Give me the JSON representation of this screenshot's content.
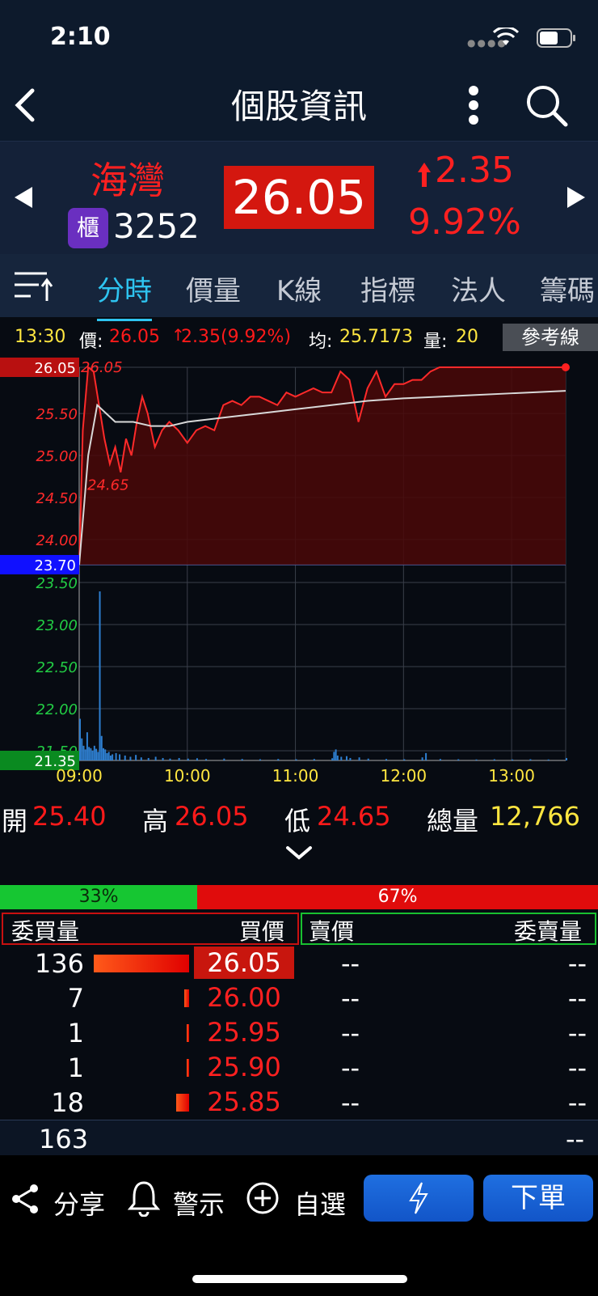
{
  "status_bar": {
    "time": "2:10"
  },
  "header": {
    "title": "個股資訊"
  },
  "stock": {
    "name": "海灣",
    "market_badge": "櫃",
    "code": "3252",
    "price": "26.05",
    "change": "2.35",
    "change_pct": "9.92%"
  },
  "tabs": [
    {
      "label": "分時",
      "active": true
    },
    {
      "label": "價量"
    },
    {
      "label": "K線"
    },
    {
      "label": "指標"
    },
    {
      "label": "法人"
    },
    {
      "label": "籌碼"
    }
  ],
  "info_line": {
    "time": "13:30",
    "price_label": "價:",
    "price": "26.05",
    "change": "2.35(9.92%)",
    "avg_label": "均:",
    "avg": "25.7173",
    "vol_label": "量:",
    "vol": "20",
    "ref_button": "參考線"
  },
  "chart_data": {
    "type": "line",
    "x_ticks": [
      "09:00",
      "10:00",
      "11:00",
      "12:00",
      "13:00"
    ],
    "price_axis": {
      "labels": [
        "26.05",
        "25.50",
        "25.00",
        "24.50",
        "24.00",
        "23.70"
      ],
      "reference": "23.70",
      "high": "26.05",
      "low": "24.65",
      "ylim": [
        23.7,
        26.05
      ]
    },
    "volume_axis": {
      "labels": [
        "23.50",
        "23.00",
        "22.50",
        "22.00",
        "21.50",
        "21.35"
      ],
      "ylim": [
        21.35,
        23.7
      ]
    },
    "price_series": {
      "x": [
        0,
        2,
        5,
        8,
        11,
        14,
        17,
        20,
        23,
        26,
        29,
        32,
        35,
        38,
        42,
        46,
        50,
        55,
        60,
        65,
        70,
        75,
        80,
        85,
        90,
        95,
        100,
        105,
        110,
        115,
        120,
        125,
        130,
        135,
        140,
        145,
        150,
        155,
        160,
        165,
        170,
        175,
        180,
        185,
        190,
        195,
        200,
        205,
        210,
        215,
        220,
        225,
        230,
        235,
        240,
        245,
        250,
        255,
        260,
        265,
        270
      ],
      "y": [
        23.7,
        25.3,
        26.05,
        26.0,
        25.6,
        25.2,
        24.9,
        25.1,
        24.8,
        25.2,
        25.0,
        25.4,
        25.7,
        25.5,
        25.1,
        25.3,
        25.4,
        25.3,
        25.15,
        25.3,
        25.35,
        25.3,
        25.6,
        25.65,
        25.6,
        25.7,
        25.7,
        25.65,
        25.6,
        25.75,
        25.7,
        25.75,
        25.8,
        25.75,
        25.75,
        26.0,
        25.9,
        25.4,
        25.8,
        26.0,
        25.7,
        25.85,
        25.85,
        25.9,
        25.9,
        26.0,
        26.05,
        26.05,
        26.05,
        26.05,
        26.05,
        26.05,
        26.05,
        26.05,
        26.05,
        26.05,
        26.05,
        26.05,
        26.05,
        26.05,
        26.05
      ]
    },
    "avg_series": {
      "x": [
        0,
        5,
        10,
        15,
        20,
        30,
        40,
        50,
        60,
        80,
        100,
        120,
        140,
        160,
        180,
        200,
        220,
        240,
        270
      ],
      "y": [
        23.7,
        25.0,
        25.6,
        25.5,
        25.4,
        25.4,
        25.35,
        25.35,
        25.4,
        25.45,
        25.5,
        25.55,
        25.6,
        25.65,
        25.68,
        25.7,
        25.72,
        25.74,
        25.77
      ]
    },
    "volume_series": {
      "x": [
        0,
        1,
        2,
        3,
        4,
        5,
        6,
        7,
        8,
        9,
        10,
        11,
        12,
        13,
        14,
        15,
        16,
        17,
        18,
        20,
        22,
        25,
        28,
        31,
        34,
        38,
        42,
        46,
        50,
        55,
        60,
        65,
        70,
        80,
        90,
        100,
        110,
        120,
        130,
        140,
        141,
        142,
        143,
        145,
        148,
        150,
        155,
        160,
        170,
        180,
        190,
        192,
        200,
        210,
        220,
        230,
        240,
        250,
        260,
        270
      ],
      "y": [
        340,
        180,
        120,
        90,
        230,
        110,
        100,
        80,
        120,
        95,
        70,
        1380,
        200,
        100,
        90,
        60,
        70,
        40,
        50,
        60,
        50,
        40,
        30,
        45,
        25,
        20,
        30,
        20,
        15,
        20,
        15,
        18,
        12,
        15,
        12,
        10,
        12,
        10,
        12,
        18,
        70,
        90,
        40,
        30,
        35,
        20,
        25,
        15,
        12,
        10,
        25,
        60,
        12,
        10,
        8,
        10,
        8,
        10,
        8,
        20
      ]
    }
  },
  "stats": {
    "open_label": "開",
    "open": "25.40",
    "high_label": "高",
    "high": "26.05",
    "low_label": "低",
    "low": "24.65",
    "total_label": "總量",
    "total": "12,766"
  },
  "ratio": {
    "buy": "33%",
    "sell": "67%",
    "buy_fraction": 0.33
  },
  "orderbook": {
    "headers": {
      "bid_qty": "委買量",
      "bid_price": "買價",
      "ask_price": "賣價",
      "ask_qty": "委賣量"
    },
    "rows": [
      {
        "qty": "136",
        "qty_num": 136,
        "bid": "26.05",
        "ask": "--",
        "ask_qty": "--"
      },
      {
        "qty": "7",
        "qty_num": 7,
        "bid": "26.00",
        "ask": "--",
        "ask_qty": "--"
      },
      {
        "qty": "1",
        "qty_num": 1,
        "bid": "25.95",
        "ask": "--",
        "ask_qty": "--"
      },
      {
        "qty": "1",
        "qty_num": 1,
        "bid": "25.90",
        "ask": "--",
        "ask_qty": "--"
      },
      {
        "qty": "18",
        "qty_num": 18,
        "bid": "25.85",
        "ask": "--",
        "ask_qty": "--"
      }
    ],
    "total_bid": "163",
    "total_ask": "--"
  },
  "bottom": {
    "share": "分享",
    "alert": "警示",
    "watch": "自選",
    "order": "下單"
  },
  "colors": {
    "up": "#ff1a1a",
    "accent": "#2ec4f0",
    "ref": "#1010ff",
    "header_bg": "#0d1a2c"
  }
}
